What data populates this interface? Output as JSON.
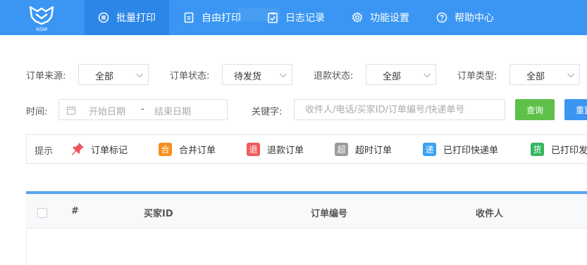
{
  "brand": {
    "logo_text": "KDM"
  },
  "nav": {
    "items": [
      {
        "label": "批量打印",
        "icon": "list-circle-icon"
      },
      {
        "label": "自由打印",
        "icon": "document-icon"
      },
      {
        "label": "日志记录",
        "icon": "clipboard-check-icon"
      },
      {
        "label": "功能设置",
        "icon": "gear-icon"
      },
      {
        "label": "帮助中心",
        "icon": "help-circle-icon"
      }
    ],
    "active_index": 0
  },
  "filters": {
    "order_source": {
      "label": "订单来源:",
      "value": "全部"
    },
    "order_status": {
      "label": "订单状态:",
      "value": "待发货"
    },
    "refund_status": {
      "label": "退款状态:",
      "value": "全部"
    },
    "order_type": {
      "label": "订单类型:",
      "value": "全部"
    },
    "time": {
      "label": "时间:",
      "start_placeholder": "开始日期",
      "separator": "-",
      "end_placeholder": "结束日期"
    },
    "keyword": {
      "label": "关键字:",
      "placeholder": "收件人/电话/买家ID/订单编号/快递单号",
      "value": ""
    },
    "query_button": "查询",
    "reset_button": "重置"
  },
  "hints": {
    "title": "提示",
    "items": [
      {
        "text": "订单标记",
        "badge": "",
        "icon": "pushpin-icon",
        "color": "#f0545b"
      },
      {
        "text": "合并订单",
        "badge": "合",
        "color": "#f7901e"
      },
      {
        "text": "退款订单",
        "badge": "退",
        "color": "#f05b5b"
      },
      {
        "text": "超时订单",
        "badge": "超",
        "color": "#9b9b9b"
      },
      {
        "text": "已打印快递单",
        "badge": "递",
        "color": "#3aa0f2"
      },
      {
        "text": "已打印发",
        "badge": "货",
        "color": "#35b65e"
      }
    ]
  },
  "table": {
    "columns": [
      "#",
      "买家ID",
      "订单编号",
      "收件人"
    ]
  },
  "colors": {
    "primary": "#3a96f2",
    "success": "#5fc04a"
  }
}
